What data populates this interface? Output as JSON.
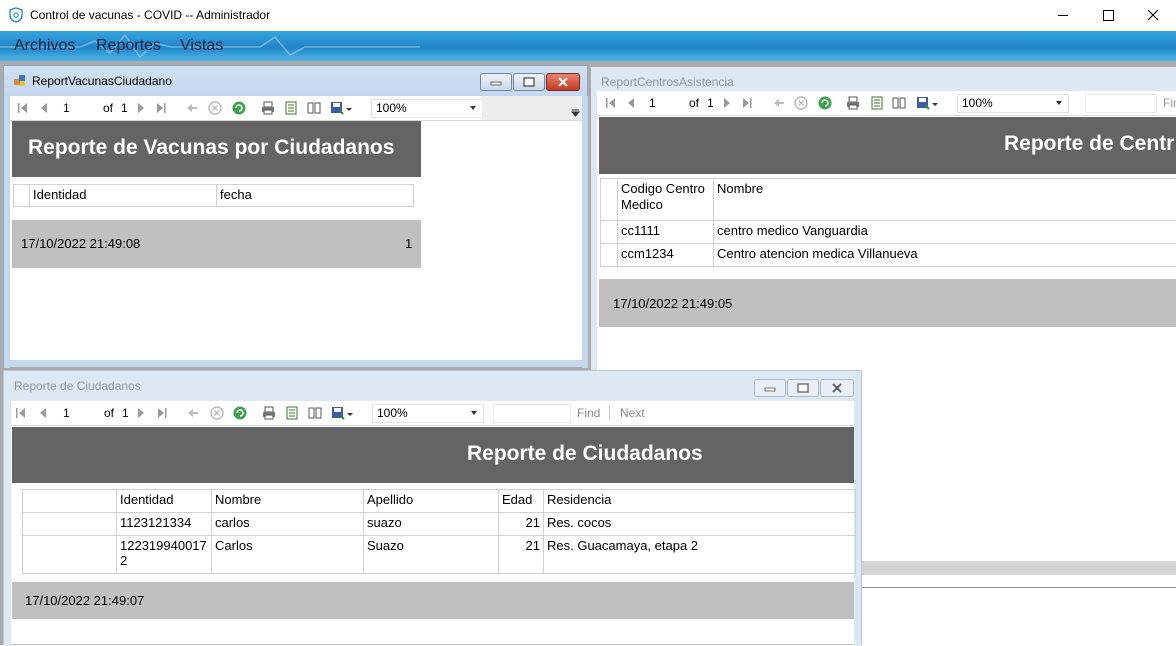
{
  "app": {
    "title": "Control de vacunas - COVID -- Administrador",
    "menu": [
      "Archivos",
      "Reportes",
      "Vistas"
    ]
  },
  "toolbar": {
    "page": "1",
    "of_label": "of",
    "total": "1",
    "zoom": "100%",
    "find": "Find",
    "next": "Next",
    "find_partial": "Fir"
  },
  "win_vacunas": {
    "title": "ReportVacunasCiudadano",
    "report_title": "Reporte de Vacunas por Ciudadanos",
    "headers": [
      "Identidad",
      "fecha"
    ],
    "timestamp": "17/10/2022 21:49:08",
    "page_number": "1"
  },
  "win_centros": {
    "title": "ReportCentrosAsistencia",
    "report_title": "Reporte de Centr",
    "headers": [
      "Codigo Centro Medico",
      "Nombre"
    ],
    "rows": [
      [
        "cc1111",
        "centro medico Vanguardia"
      ],
      [
        "ccm1234",
        "Centro atencion medica Villanueva"
      ]
    ],
    "timestamp": "17/10/2022 21:49:05"
  },
  "win_ciudadanos": {
    "title": "Reporte de Ciudadanos",
    "report_title": "Reporte de Ciudadanos",
    "headers": [
      "Identidad",
      "Nombre",
      "Apellido",
      "Edad",
      "Residencia"
    ],
    "rows": [
      [
        "1123121334",
        "carlos",
        "suazo",
        "21",
        "Res. cocos"
      ],
      [
        "122319940017\n2",
        "Carlos",
        "Suazo",
        "21",
        "Res. Guacamaya, etapa 2"
      ]
    ],
    "timestamp": "17/10/2022 21:49:07"
  },
  "colors": {
    "header_bg": "#646464",
    "footer_bg": "#c0c0c0",
    "menu_bg": "#2b95d6"
  }
}
